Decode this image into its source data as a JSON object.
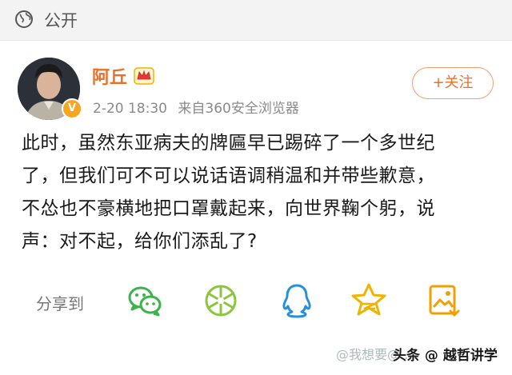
{
  "header": {
    "visibility_label": "公开",
    "icon": "globe-icon"
  },
  "post": {
    "author": "阿丘",
    "timestamp": "2-20 18:30",
    "source": "来自360安全浏览器",
    "follow_label": "+关注",
    "text_lines": [
      "此时，虽然东亚病夫的牌匾早已踢碎了一个多世纪",
      "了，但我们可不可以说话语调稍温和并带些歉意，",
      "不怂也不豪横地把口罩戴起来，向世界鞠个躬，说",
      "声：对不起，给你们添乱了?"
    ]
  },
  "share": {
    "label": "分享到",
    "targets": [
      "wechat-icon",
      "moments-icon",
      "qq-icon",
      "qzone-icon",
      "save-image-icon"
    ]
  },
  "watermark": {
    "faded": "@我想要@...",
    "strong": "头条 @ 越哲讲学"
  },
  "colors": {
    "accent": "#e8702a",
    "share_green": "#3cb34a",
    "share_blue": "#2a8fd8",
    "share_gold": "#f0b400"
  }
}
